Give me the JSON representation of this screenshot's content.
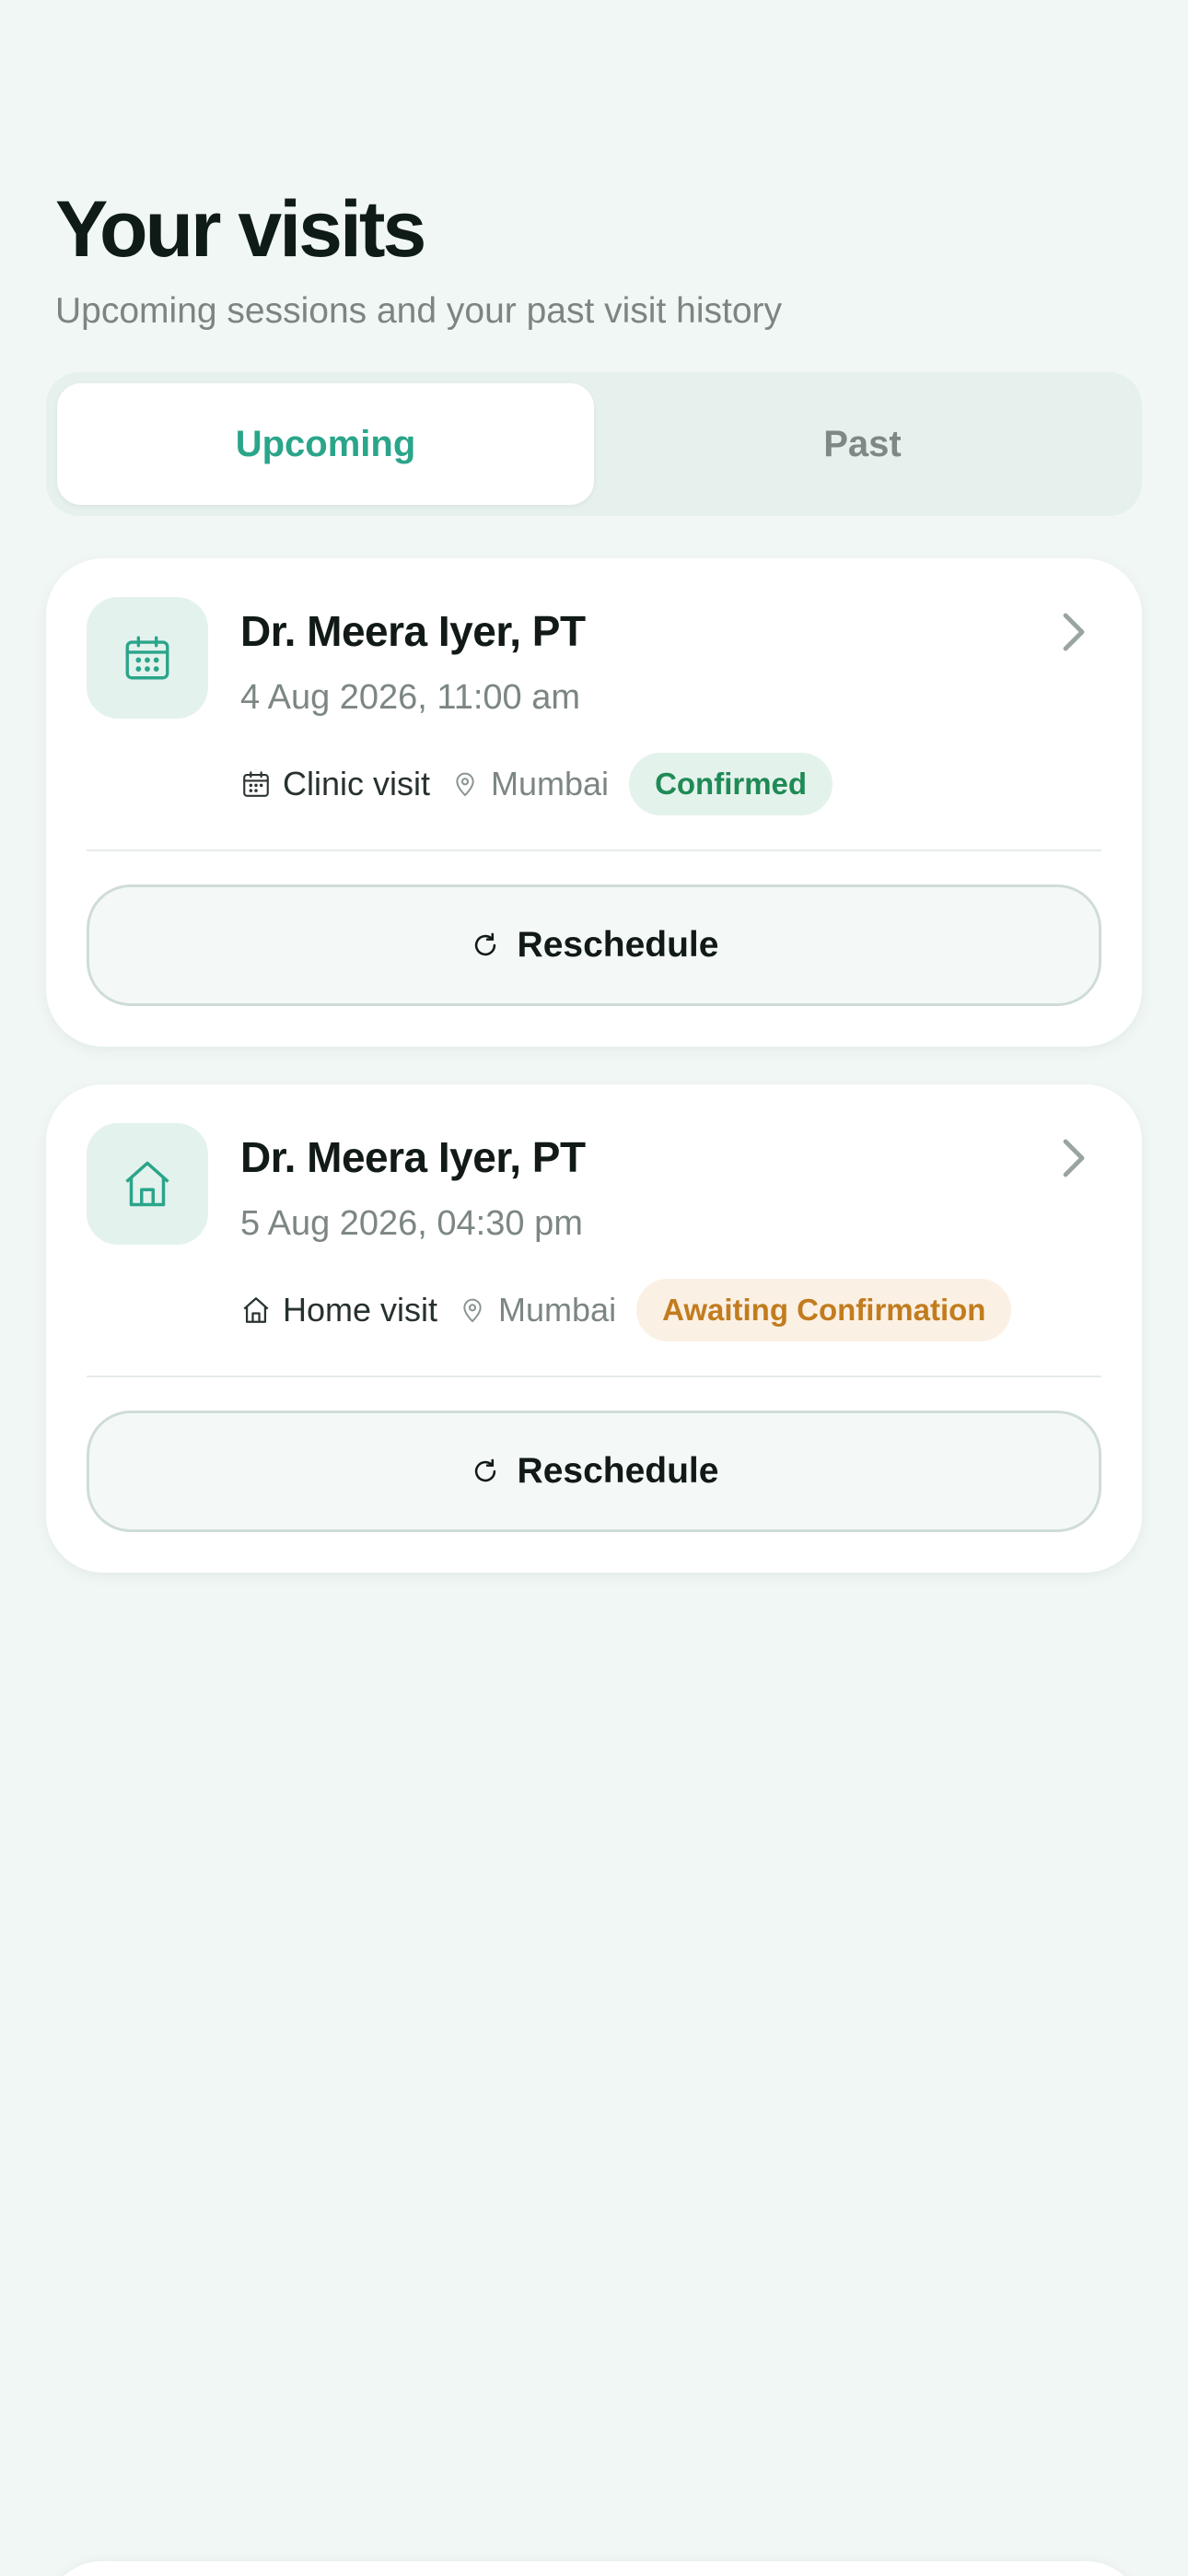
{
  "header": {
    "title": "Your visits",
    "subtitle": "Upcoming sessions and your past visit history"
  },
  "tabs": [
    {
      "label": "Upcoming",
      "active": true
    },
    {
      "label": "Past",
      "active": false
    }
  ],
  "visits": [
    {
      "doctor": "Dr. Meera Iyer, PT",
      "datetime": "4 Aug 2026, 11:00 am",
      "type_label": "Clinic visit",
      "type_icon": "calendar-icon",
      "city": "Mumbai",
      "status": "Confirmed",
      "status_color": "#1f8a55",
      "action_label": "Reschedule"
    },
    {
      "doctor": "Dr. Meera Iyer, PT",
      "datetime": "5 Aug 2026, 04:30 pm",
      "type_label": "Home visit",
      "type_icon": "home-icon",
      "city": "Mumbai",
      "status": "Awaiting Confirmation",
      "status_color": "#c27c1e",
      "action_label": "Reschedule"
    }
  ],
  "colors": {
    "accent": "#2aa58a",
    "background": "#f1f7f5"
  }
}
